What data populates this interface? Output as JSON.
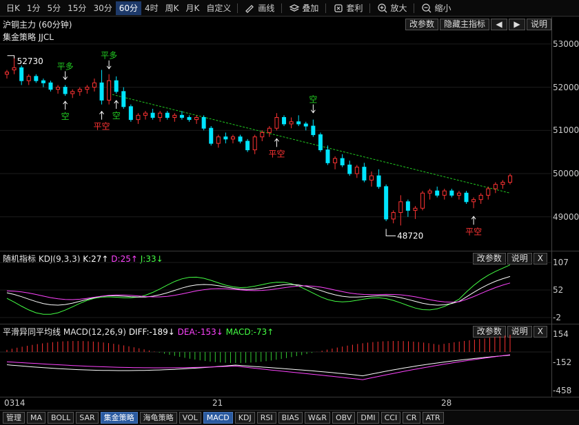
{
  "toolbar": {
    "periods": [
      "日K",
      "1分",
      "5分",
      "15分",
      "30分",
      "60分",
      "4时",
      "周K",
      "月K",
      "自定义"
    ],
    "active_period": "60分",
    "tools": [
      {
        "label": "画线",
        "icon": "pencil-icon"
      },
      {
        "label": "叠加",
        "icon": "layers-icon"
      },
      {
        "label": "套利",
        "icon": "arbitrage-icon"
      },
      {
        "label": "放大",
        "icon": "zoom-in-icon"
      },
      {
        "label": "缩小",
        "icon": "zoom-out-icon"
      }
    ]
  },
  "main_panel": {
    "title": "沪铜主力 (60分钟)",
    "subtitle": "集金策略 JJCL",
    "buttons": {
      "edit": "改参数",
      "hide": "隐藏主指标",
      "prev": "◀",
      "next": "▶",
      "help": "说明"
    },
    "y_labels": [
      "53000",
      "52000",
      "51000",
      "50000",
      "49000"
    ],
    "annotations": {
      "high": "52730",
      "low": "48720",
      "signals": [
        {
          "text": "平多",
          "color": "#22cc22"
        },
        {
          "text": "空",
          "color": "#22cc22"
        },
        {
          "text": "平多",
          "color": "#22cc22"
        },
        {
          "text": "平空",
          "color": "#ff3333"
        },
        {
          "text": "空",
          "color": "#22cc22"
        },
        {
          "text": "平空",
          "color": "#ff3333"
        },
        {
          "text": "空",
          "color": "#22cc22"
        },
        {
          "text": "平空",
          "color": "#ff3333"
        }
      ]
    }
  },
  "kdj_panel": {
    "name": "随机指标",
    "params": "KDJ(9,3,3)",
    "k": "K:27↑",
    "d": "D:25↑",
    "j": "J:33↓",
    "buttons": {
      "edit": "改参数",
      "help": "说明",
      "close": "X"
    },
    "y_labels": [
      "107",
      "52",
      "-2"
    ]
  },
  "macd_panel": {
    "name": "平滑异同平均线",
    "params": "MACD(12,26,9)",
    "diff": "DIFF:-189↓",
    "dea": "DEA:-153↓",
    "macd": "MACD:-73↑",
    "buttons": {
      "edit": "改参数",
      "help": "说明",
      "close": "X"
    },
    "y_labels": [
      "154",
      "-152",
      "-458"
    ]
  },
  "date_axis": [
    "0314",
    "21",
    "28"
  ],
  "tabs": [
    "管理",
    "MA",
    "BOLL",
    "SAR",
    "集金策略",
    "海龟策略",
    "VOL",
    "MACD",
    "KDJ",
    "RSI",
    "BIAS",
    "W&R",
    "OBV",
    "DMI",
    "CCI",
    "CR",
    "ATR"
  ],
  "active_tabs": [
    "集金策略",
    "MACD"
  ],
  "colors": {
    "up": "#ff3333",
    "down": "#00e5ff",
    "k_line": "#ffffff",
    "d_line": "#ff44ff",
    "j_line": "#44ff44",
    "diff_line": "#ffffff",
    "dea_line": "#ff44ff",
    "macd_pos": "#ff3333",
    "macd_neg": "#33cc33",
    "trend_line": "#22cc22"
  },
  "chart_data": {
    "type": "candlestick",
    "title": "沪铜主力 (60分钟)",
    "ylim": [
      48200,
      53300
    ],
    "annotated_high": 52730,
    "annotated_low": 48720,
    "series": [
      {
        "name": "candles",
        "ohlc": [
          [
            52300,
            52400,
            52200,
            52350
          ],
          [
            52400,
            52730,
            52300,
            52450
          ],
          [
            52450,
            52500,
            52050,
            52150
          ],
          [
            52150,
            52300,
            52050,
            52250
          ],
          [
            52250,
            52300,
            52100,
            52150
          ],
          [
            52150,
            52200,
            52000,
            52100
          ],
          [
            52100,
            52150,
            51900,
            51950
          ],
          [
            51950,
            52050,
            51850,
            52000
          ],
          [
            52000,
            52050,
            51800,
            51850
          ],
          [
            51850,
            51950,
            51750,
            51900
          ],
          [
            51900,
            52000,
            51800,
            51950
          ],
          [
            51950,
            52050,
            51850,
            52000
          ],
          [
            52000,
            52200,
            51900,
            52100
          ],
          [
            52100,
            52400,
            51600,
            51700
          ],
          [
            51700,
            52300,
            51600,
            52150
          ],
          [
            52150,
            52250,
            51850,
            51900
          ],
          [
            51900,
            52000,
            51500,
            51550
          ],
          [
            51550,
            51600,
            51200,
            51250
          ],
          [
            51250,
            51400,
            51150,
            51350
          ],
          [
            51350,
            51450,
            51250,
            51400
          ],
          [
            51400,
            51500,
            51250,
            51300
          ],
          [
            51300,
            51450,
            51200,
            51400
          ],
          [
            51400,
            51450,
            51250,
            51300
          ],
          [
            51300,
            51400,
            51200,
            51350
          ],
          [
            51350,
            51450,
            51250,
            51300
          ],
          [
            51300,
            51350,
            51200,
            51250
          ],
          [
            51250,
            51350,
            51150,
            51300
          ],
          [
            51300,
            51350,
            51000,
            51050
          ],
          [
            51050,
            51100,
            50650,
            50700
          ],
          [
            50700,
            50900,
            50600,
            50850
          ],
          [
            50850,
            50950,
            50700,
            50800
          ],
          [
            50800,
            50900,
            50700,
            50850
          ],
          [
            50850,
            50900,
            50700,
            50750
          ],
          [
            50750,
            50800,
            50500,
            50550
          ],
          [
            50550,
            50900,
            50450,
            50850
          ],
          [
            50850,
            51000,
            50750,
            50950
          ],
          [
            50950,
            51100,
            50850,
            51050
          ],
          [
            51050,
            51400,
            51000,
            51300
          ],
          [
            51300,
            51350,
            51100,
            51150
          ],
          [
            51150,
            51300,
            51050,
            51200
          ],
          [
            51200,
            51350,
            51100,
            51150
          ],
          [
            51150,
            51200,
            51000,
            51100
          ],
          [
            51100,
            51250,
            50850,
            50900
          ],
          [
            50900,
            50950,
            50500,
            50550
          ],
          [
            50550,
            50650,
            50200,
            50250
          ],
          [
            50250,
            50400,
            50100,
            50350
          ],
          [
            50350,
            50450,
            50150,
            50200
          ],
          [
            50200,
            50300,
            49950,
            50000
          ],
          [
            50000,
            50200,
            49900,
            50150
          ],
          [
            50150,
            50250,
            49800,
            49850
          ],
          [
            49850,
            50050,
            49700,
            49950
          ],
          [
            49950,
            50100,
            49650,
            49700
          ],
          [
            49700,
            49750,
            48900,
            48950
          ],
          [
            48950,
            49150,
            48850,
            49100
          ],
          [
            49100,
            49500,
            48800,
            49350
          ],
          [
            49350,
            49400,
            49000,
            49150
          ],
          [
            49150,
            49250,
            48950,
            49200
          ],
          [
            49200,
            49600,
            49150,
            49550
          ],
          [
            49550,
            49650,
            49400,
            49600
          ],
          [
            49600,
            49700,
            49450,
            49500
          ],
          [
            49500,
            49650,
            49400,
            49600
          ],
          [
            49600,
            49650,
            49450,
            49500
          ],
          [
            49500,
            49600,
            49400,
            49550
          ],
          [
            49550,
            49600,
            49300,
            49350
          ],
          [
            49350,
            49450,
            49200,
            49400
          ],
          [
            49400,
            49550,
            49300,
            49500
          ],
          [
            49500,
            49700,
            49400,
            49650
          ],
          [
            49650,
            49800,
            49550,
            49750
          ],
          [
            49750,
            49850,
            49650,
            49800
          ],
          [
            49800,
            50000,
            49750,
            49950
          ]
        ]
      },
      {
        "name": "trend",
        "x": [
          14,
          69
        ],
        "y": [
          51850,
          49550
        ]
      }
    ]
  }
}
